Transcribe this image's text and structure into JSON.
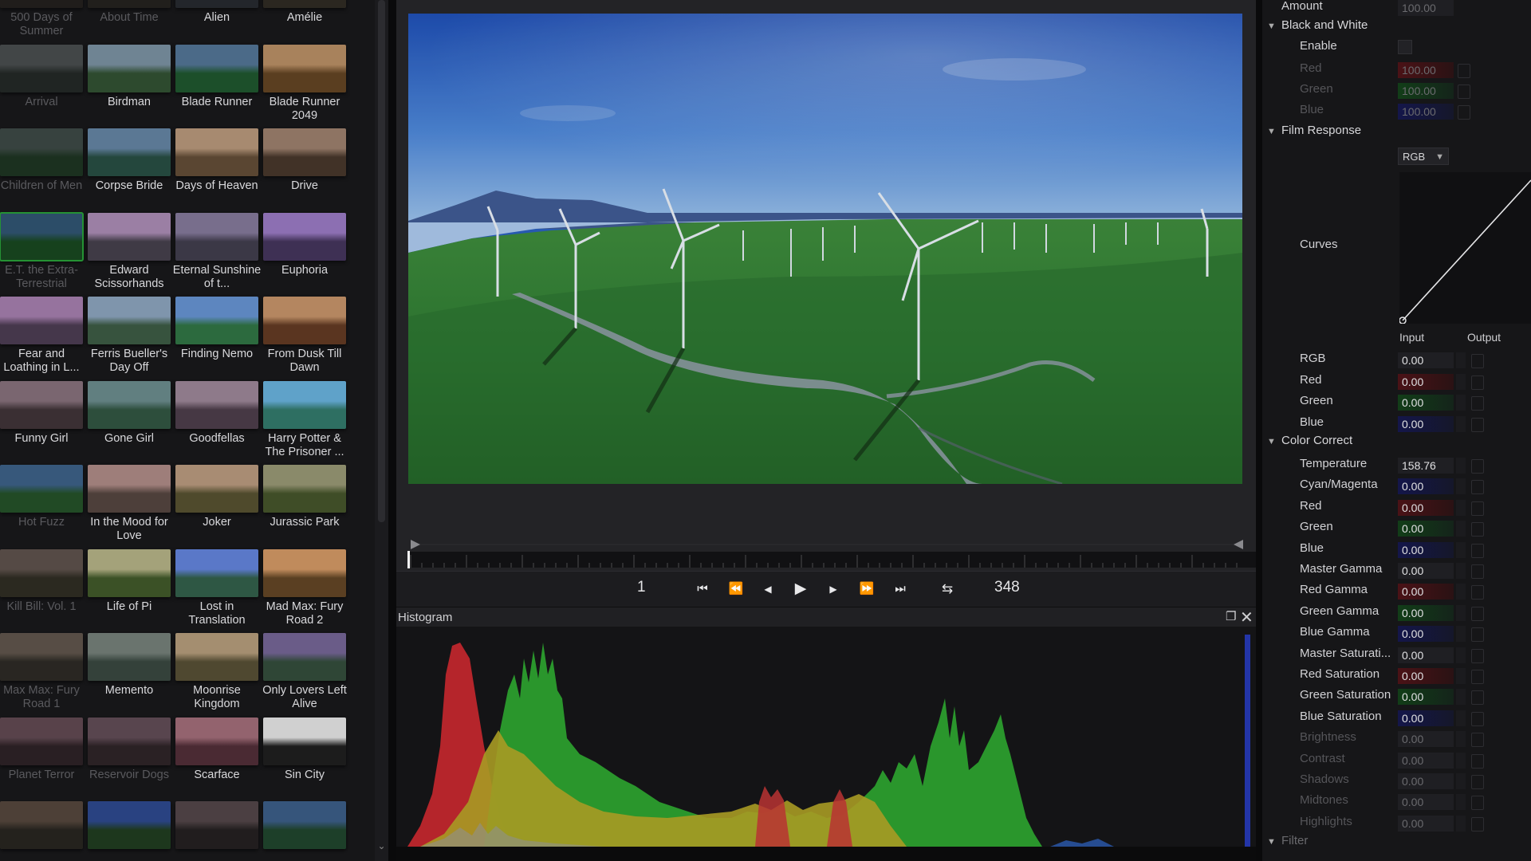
{
  "luts": [
    {
      "label": "500 Days of Summer",
      "dim": true,
      "tone": [
        "#5a4c47",
        "#2d2a26"
      ]
    },
    {
      "label": "About Time",
      "dim": true,
      "tone": [
        "#5c564e",
        "#2f2c28"
      ]
    },
    {
      "label": "Alien",
      "tone": [
        "#4f5258",
        "#23262b"
      ]
    },
    {
      "label": "Amélie",
      "tone": [
        "#5d5446",
        "#2b2720"
      ]
    },
    {
      "label": "Arrival",
      "dim": true,
      "tone": [
        "#5e6466",
        "#2e3532"
      ]
    },
    {
      "label": "Birdman",
      "tone": [
        "#6f8493",
        "#2d4a2e"
      ]
    },
    {
      "label": "Blade Runner",
      "tone": [
        "#4b6a88",
        "#1c4f2a"
      ]
    },
    {
      "label": "Blade Runner 2049",
      "tone": [
        "#a8825c",
        "#5a3e20"
      ]
    },
    {
      "label": "Children of Men",
      "dim": true,
      "tone": [
        "#4f5f5a",
        "#26452c"
      ]
    },
    {
      "label": "Corpse Bride",
      "tone": [
        "#5b7894",
        "#24473d"
      ]
    },
    {
      "label": "Days of Heaven",
      "tone": [
        "#a78a70",
        "#5a4632"
      ]
    },
    {
      "label": "Drive",
      "tone": [
        "#8e7463",
        "#413227"
      ]
    },
    {
      "label": "E.T. the Extra-Terrestrial",
      "dim": true,
      "selected": true,
      "tone": [
        "#3f6e94",
        "#1f5d2a"
      ]
    },
    {
      "label": "Edward Scissorhands",
      "tone": [
        "#9b7fa4",
        "#3f3a45"
      ]
    },
    {
      "label": "Eternal Sunshine of t...",
      "tone": [
        "#786e8c",
        "#3b3846"
      ]
    },
    {
      "label": "Euphoria",
      "tone": [
        "#8c6fb2",
        "#3e3054"
      ]
    },
    {
      "label": "Fear and Loathing in L...",
      "tone": [
        "#96739e",
        "#45374b"
      ]
    },
    {
      "label": "Ferris Bueller's Day Off",
      "tone": [
        "#7f95ac",
        "#37533e"
      ]
    },
    {
      "label": "Finding Nemo",
      "tone": [
        "#5d86bf",
        "#2c6a3e"
      ]
    },
    {
      "label": "From Dusk Till Dawn",
      "tone": [
        "#b48660",
        "#5a3520"
      ]
    },
    {
      "label": "Funny Girl",
      "tone": [
        "#7a6670",
        "#3a2f33"
      ]
    },
    {
      "label": "Gone Girl",
      "tone": [
        "#617f80",
        "#2d4e3c"
      ]
    },
    {
      "label": "Goodfellas",
      "tone": [
        "#8e7a8a",
        "#463844"
      ]
    },
    {
      "label": "Harry Potter & The Prisoner ...",
      "tone": [
        "#5fa2c9",
        "#2e6f62"
      ]
    },
    {
      "label": "Hot Fuzz",
      "dim": true,
      "tone": [
        "#4f7db0",
        "#2f6a35"
      ]
    },
    {
      "label": "In the Mood for Love",
      "tone": [
        "#9e7e7a",
        "#4d3f3a"
      ]
    },
    {
      "label": "Joker",
      "tone": [
        "#a88c73",
        "#4f4a2c"
      ]
    },
    {
      "label": "Jurassic Park",
      "tone": [
        "#8a8a6a",
        "#3f4d27"
      ]
    },
    {
      "label": "Kill Bill: Vol. 1",
      "dim": true,
      "tone": [
        "#7a6a62",
        "#3d3a2e"
      ]
    },
    {
      "label": "Life of Pi",
      "tone": [
        "#a4a27a",
        "#3b5126"
      ]
    },
    {
      "label": "Lost in Translation",
      "tone": [
        "#5a78c8",
        "#2e5744"
      ]
    },
    {
      "label": "Mad Max: Fury Road 2",
      "tone": [
        "#c08b5c",
        "#5a3f22"
      ]
    },
    {
      "label": "Max Max: Fury Road 1",
      "dim": true,
      "tone": [
        "#7c6e62",
        "#3a3730"
      ]
    },
    {
      "label": "Memento",
      "tone": [
        "#6a746e",
        "#34413a"
      ]
    },
    {
      "label": "Moonrise Kingdom",
      "tone": [
        "#a48e70",
        "#4f4830"
      ]
    },
    {
      "label": "Only Lovers Left Alive",
      "tone": [
        "#6a5c88",
        "#2f4636"
      ]
    },
    {
      "label": "Planet Terror",
      "dim": true,
      "tone": [
        "#7d5f6a",
        "#3b2c32"
      ]
    },
    {
      "label": "Reservoir Dogs",
      "dim": true,
      "tone": [
        "#7e6270",
        "#3c2f33"
      ]
    },
    {
      "label": "Scarface",
      "tone": [
        "#93636e",
        "#4a2a33"
      ]
    },
    {
      "label": "Sin City",
      "tone": [
        "#d0d0d0",
        "#1c1c1c"
      ]
    },
    {
      "label": "",
      "dim": true,
      "tone": [
        "#6e5c4e",
        "#34302a"
      ]
    },
    {
      "label": "",
      "dim": true,
      "tone": [
        "#3a5fb8",
        "#2a4f2a"
      ]
    },
    {
      "label": "",
      "dim": true,
      "tone": [
        "#6b5a5e",
        "#2f2a2b"
      ]
    },
    {
      "label": "",
      "dim": true,
      "tone": [
        "#4d7ab0",
        "#2a5a3a"
      ]
    }
  ],
  "transport": {
    "start_frame": "1",
    "end_frame": "348",
    "icons": {
      "first": "⏮",
      "rewind": "⏪",
      "step_back": "◀",
      "play": "▶",
      "step_forward": "▶",
      "fast_forward": "⏩",
      "last": "⏭",
      "loop": "⇆"
    }
  },
  "histogram": {
    "title": "Histogram",
    "float_icon": "❐",
    "close_icon": "✕"
  },
  "inspector": {
    "amount": {
      "label": "Amount",
      "value": "100.00"
    },
    "bw": {
      "title": "Black and White",
      "enable_label": "Enable",
      "red": {
        "label": "Red",
        "value": "100.00"
      },
      "green": {
        "label": "Green",
        "value": "100.00"
      },
      "blue": {
        "label": "Blue",
        "value": "100.00"
      }
    },
    "film": {
      "title": "Film Response",
      "channel": "RGB",
      "curves_label": "Curves",
      "col_input": "Input",
      "col_output": "Output",
      "rows": [
        {
          "label": "RGB",
          "value": "0.00",
          "color": ""
        },
        {
          "label": "Red",
          "value": "0.00",
          "color": "red"
        },
        {
          "label": "Green",
          "value": "0.00",
          "color": "green"
        },
        {
          "label": "Blue",
          "value": "0.00",
          "color": "blue"
        }
      ]
    },
    "cc": {
      "title": "Color Correct",
      "rows": [
        {
          "label": "Temperature",
          "value": "158.76",
          "color": ""
        },
        {
          "label": "Cyan/Magenta",
          "value": "0.00",
          "color": "blue"
        },
        {
          "label": "Red",
          "value": "0.00",
          "color": "red"
        },
        {
          "label": "Green",
          "value": "0.00",
          "color": "green"
        },
        {
          "label": "Blue",
          "value": "0.00",
          "color": "blue"
        },
        {
          "label": "Master Gamma",
          "value": "0.00",
          "color": ""
        },
        {
          "label": "Red Gamma",
          "value": "0.00",
          "color": "red"
        },
        {
          "label": "Green Gamma",
          "value": "0.00",
          "color": "green"
        },
        {
          "label": "Blue Gamma",
          "value": "0.00",
          "color": "blue"
        },
        {
          "label": "Master Saturati...",
          "value": "0.00",
          "color": ""
        },
        {
          "label": "Red Saturation",
          "value": "0.00",
          "color": "red"
        },
        {
          "label": "Green Saturation",
          "value": "0.00",
          "color": "green"
        },
        {
          "label": "Blue Saturation",
          "value": "0.00",
          "color": "blue"
        },
        {
          "label": "Brightness",
          "value": "0.00",
          "color": "",
          "faded": true
        },
        {
          "label": "Contrast",
          "value": "0.00",
          "color": "",
          "faded": true
        },
        {
          "label": "Shadows",
          "value": "0.00",
          "color": "",
          "faded": true
        },
        {
          "label": "Midtones",
          "value": "0.00",
          "color": "",
          "faded": true
        },
        {
          "label": "Highlights",
          "value": "0.00",
          "color": "",
          "faded": true
        }
      ]
    },
    "filter": {
      "title": "Filter"
    }
  }
}
